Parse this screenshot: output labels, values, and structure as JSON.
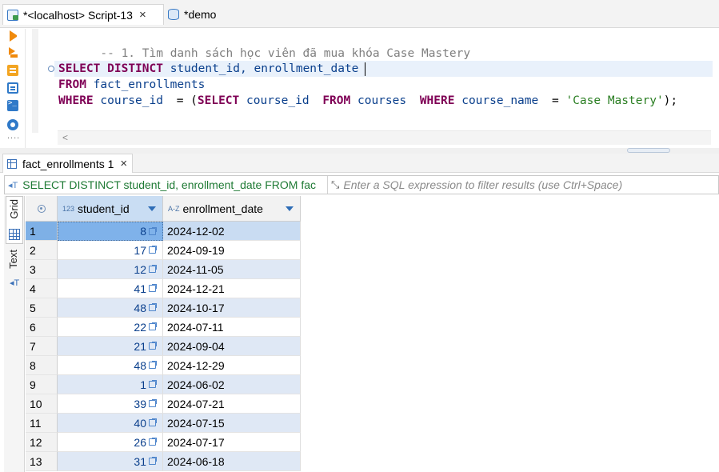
{
  "editor_tabs": [
    {
      "label": "*<localhost> Script-13",
      "icon": "sql-script-icon",
      "active": true
    },
    {
      "label": "*demo",
      "icon": "database-icon",
      "active": false
    }
  ],
  "toolbar_icons": [
    "execute-statement-icon",
    "execute-script-icon",
    "explain-plan-icon",
    "load-plan-icon",
    "console-icon",
    "settings-icon",
    "more-icon"
  ],
  "editor": {
    "comment": "-- 1. Tìm danh sách học viên đã mua khóa Case Mastery",
    "line2": {
      "kw1": "SELECT",
      "kw2": "DISTINCT",
      "ids": "student_id, enrollment_date"
    },
    "line3": {
      "kw": "FROM",
      "table": "fact_enrollments"
    },
    "line4": {
      "kw_where": "WHERE",
      "col": "course_id",
      "eq": " = (",
      "kw_select": "SELECT",
      "col2": "course_id",
      "kw_from": "FROM",
      "table": "courses",
      "kw_where2": "WHERE",
      "col3": "course_name",
      "eq2": " = ",
      "str": "'Case Mastery'",
      "end": ");"
    }
  },
  "results": {
    "tab_label": "fact_enrollments 1",
    "query_text": "SELECT DISTINCT student_id, enrollment_date FROM fac",
    "filter_placeholder": "Enter a SQL expression to filter results (use Ctrl+Space)",
    "view_tabs": [
      "Grid",
      "Text"
    ],
    "columns": [
      {
        "name": "student_id",
        "type_badge": "123"
      },
      {
        "name": "enrollment_date",
        "type_badge": "A-Z"
      }
    ],
    "rows": [
      {
        "n": "1",
        "id": "8",
        "date": "2024-12-02"
      },
      {
        "n": "2",
        "id": "17",
        "date": "2024-09-19"
      },
      {
        "n": "3",
        "id": "12",
        "date": "2024-11-05"
      },
      {
        "n": "4",
        "id": "41",
        "date": "2024-12-21"
      },
      {
        "n": "5",
        "id": "48",
        "date": "2024-10-17"
      },
      {
        "n": "6",
        "id": "22",
        "date": "2024-07-11"
      },
      {
        "n": "7",
        "id": "21",
        "date": "2024-09-04"
      },
      {
        "n": "8",
        "id": "48",
        "date": "2024-12-29"
      },
      {
        "n": "9",
        "id": "1",
        "date": "2024-06-02"
      },
      {
        "n": "10",
        "id": "39",
        "date": "2024-07-21"
      },
      {
        "n": "11",
        "id": "40",
        "date": "2024-07-15"
      },
      {
        "n": "12",
        "id": "26",
        "date": "2024-07-17"
      },
      {
        "n": "13",
        "id": "31",
        "date": "2024-06-18"
      }
    ]
  }
}
